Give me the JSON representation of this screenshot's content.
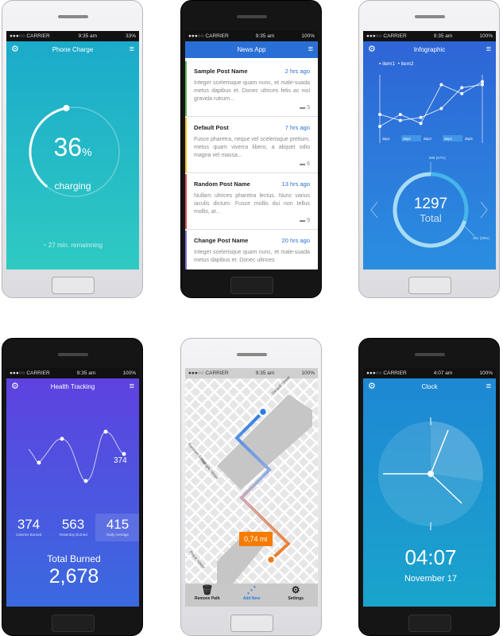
{
  "phones": {
    "charge": {
      "carrier": "●●●○○ CARRIER",
      "time": "9:35 am",
      "battery": "33%",
      "title": "Phone Charge",
      "percent": "36",
      "percent_sign": "%",
      "status": "charging",
      "remaining": "~ 27 min. remainning",
      "progress": 0.36,
      "color": "#1eb6c9"
    },
    "news": {
      "carrier": "●●●○○ CARRIER",
      "time": "9:35 am",
      "battery": "100%",
      "title": "News App",
      "accent": "#2a6fd6",
      "posts": [
        {
          "name": "Sample Post Name",
          "time": "2 hrs ago",
          "excerpt": "Integer scelerisque quam nunc, et male-suada metus dapibus et. Donec ultrices felis ac nisl gravida rutrum...",
          "comments": "3",
          "color": "#5cb85c"
        },
        {
          "name": "Default Post",
          "time": "7 hrs ago",
          "excerpt": "Fusce pharetra, neque vel scelerisque pretium, metus quam viverra libero, a aliquet odio magna vel massa...",
          "comments": "6",
          "color": "#f0c419"
        },
        {
          "name": "Random Post Name",
          "time": "13 hrs ago",
          "excerpt": "Nullam ultrices pharetra lectus. Nunc varius iaculis dictum. Fusce mollis dui non tellus mollis, at...",
          "comments": "9",
          "color": "#e0505a"
        },
        {
          "name": "Change Post Name",
          "time": "20 hrs ago",
          "excerpt": "Integer scelerisque quam nunc, et male-suada metus dapibus et. Donec ultrices",
          "comments": "",
          "color": "#7b6fd6"
        }
      ]
    },
    "infographic": {
      "carrier": "●●●○○ CARRIER",
      "time": "9:35 am",
      "battery": "100%",
      "title": "Infographic",
      "legend": [
        "item1",
        "item2"
      ],
      "days": [
        "day1",
        "day2",
        "day3",
        "day4",
        "day5"
      ],
      "item1": [
        2,
        4,
        2.5,
        9,
        7.5,
        9.5
      ],
      "item2": [
        4,
        3,
        3.5,
        5,
        8.5,
        9
      ],
      "total": "1297",
      "total_label": "Total",
      "seg1": "906 (67%)",
      "seg2": "391 (33%)",
      "seg1_fraction": 0.7
    },
    "health": {
      "carrier": "●●●○○ CARRIER",
      "time": "9:35 am",
      "battery": "100%",
      "title": "Health Tracking",
      "curve_label": "374",
      "stats": [
        {
          "value": "374",
          "label": "Calories Burned"
        },
        {
          "value": "563",
          "label": "Yesterday Burned"
        },
        {
          "value": "415",
          "label": "Daily Average"
        }
      ],
      "total_label": "Total Burned",
      "total": "2,678"
    },
    "map": {
      "carrier": "●●●○○ CARRIER",
      "time": "9:35 am",
      "battery": "100%",
      "distance": "0,74 mi",
      "streets": [
        "Random Street",
        "Sample Street",
        "Default Street",
        "Place Street"
      ],
      "tabs": [
        {
          "label": "Remove Path",
          "icon": "trash-icon"
        },
        {
          "label": "Add New",
          "icon": "share-icon"
        },
        {
          "label": "Settings",
          "icon": "gear-icon"
        }
      ],
      "active_tab": "Add New"
    },
    "clock": {
      "carrier": "●●●○○ CARRIER",
      "time": "4:07 am",
      "battery": "100%",
      "title": "Clock",
      "digital": "04:07",
      "date": "November 17"
    }
  }
}
